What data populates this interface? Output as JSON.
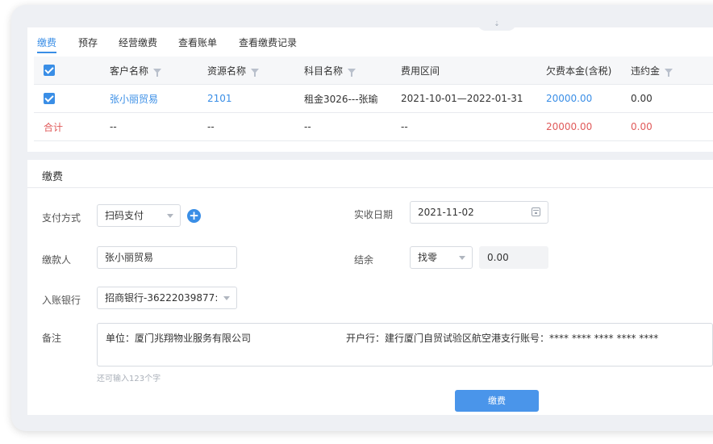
{
  "tabs": [
    "缴费",
    "预存",
    "经营缴费",
    "查看账单",
    "查看缴费记录"
  ],
  "table": {
    "headers": [
      "客户名称",
      "资源名称",
      "科目名称",
      "费用区间",
      "欠费本金(含税)",
      "违约金"
    ],
    "row": {
      "customer": "张小丽贸易",
      "resource": "2101",
      "subject": "租金3026---张瑜",
      "period": "2021-10-01—2022-01-31",
      "principal": "20000.00",
      "penalty": "0.00"
    },
    "total": {
      "label": "合计",
      "customer": "--",
      "resource": "--",
      "subject": "--",
      "period": "--",
      "principal": "20000.00",
      "penalty": "0.00"
    }
  },
  "form": {
    "section_title": "缴费",
    "pay_method_label": "支付方式",
    "pay_method_value": "扫码支付",
    "date_label": "实收日期",
    "date_value": "2021-11-02",
    "payer_label": "缴款人",
    "payer_value": "张小丽贸易",
    "balance_label": "结余",
    "balance_mode": "找零",
    "balance_value": "0.00",
    "bank_label": "入账银行",
    "bank_value": "招商银行-36222039877:",
    "remark_label": "备注",
    "remark_left": "单位：厦门兆翔物业服务有限公司",
    "remark_right": "开户行：建行厦门自贸试验区航空港支行账号：**** **** **** **** ****",
    "remark_hint": "还可输入123个字",
    "submit_label": "缴费"
  },
  "colors": {
    "accent": "#3a8ee6",
    "danger": "#e05a5a"
  }
}
